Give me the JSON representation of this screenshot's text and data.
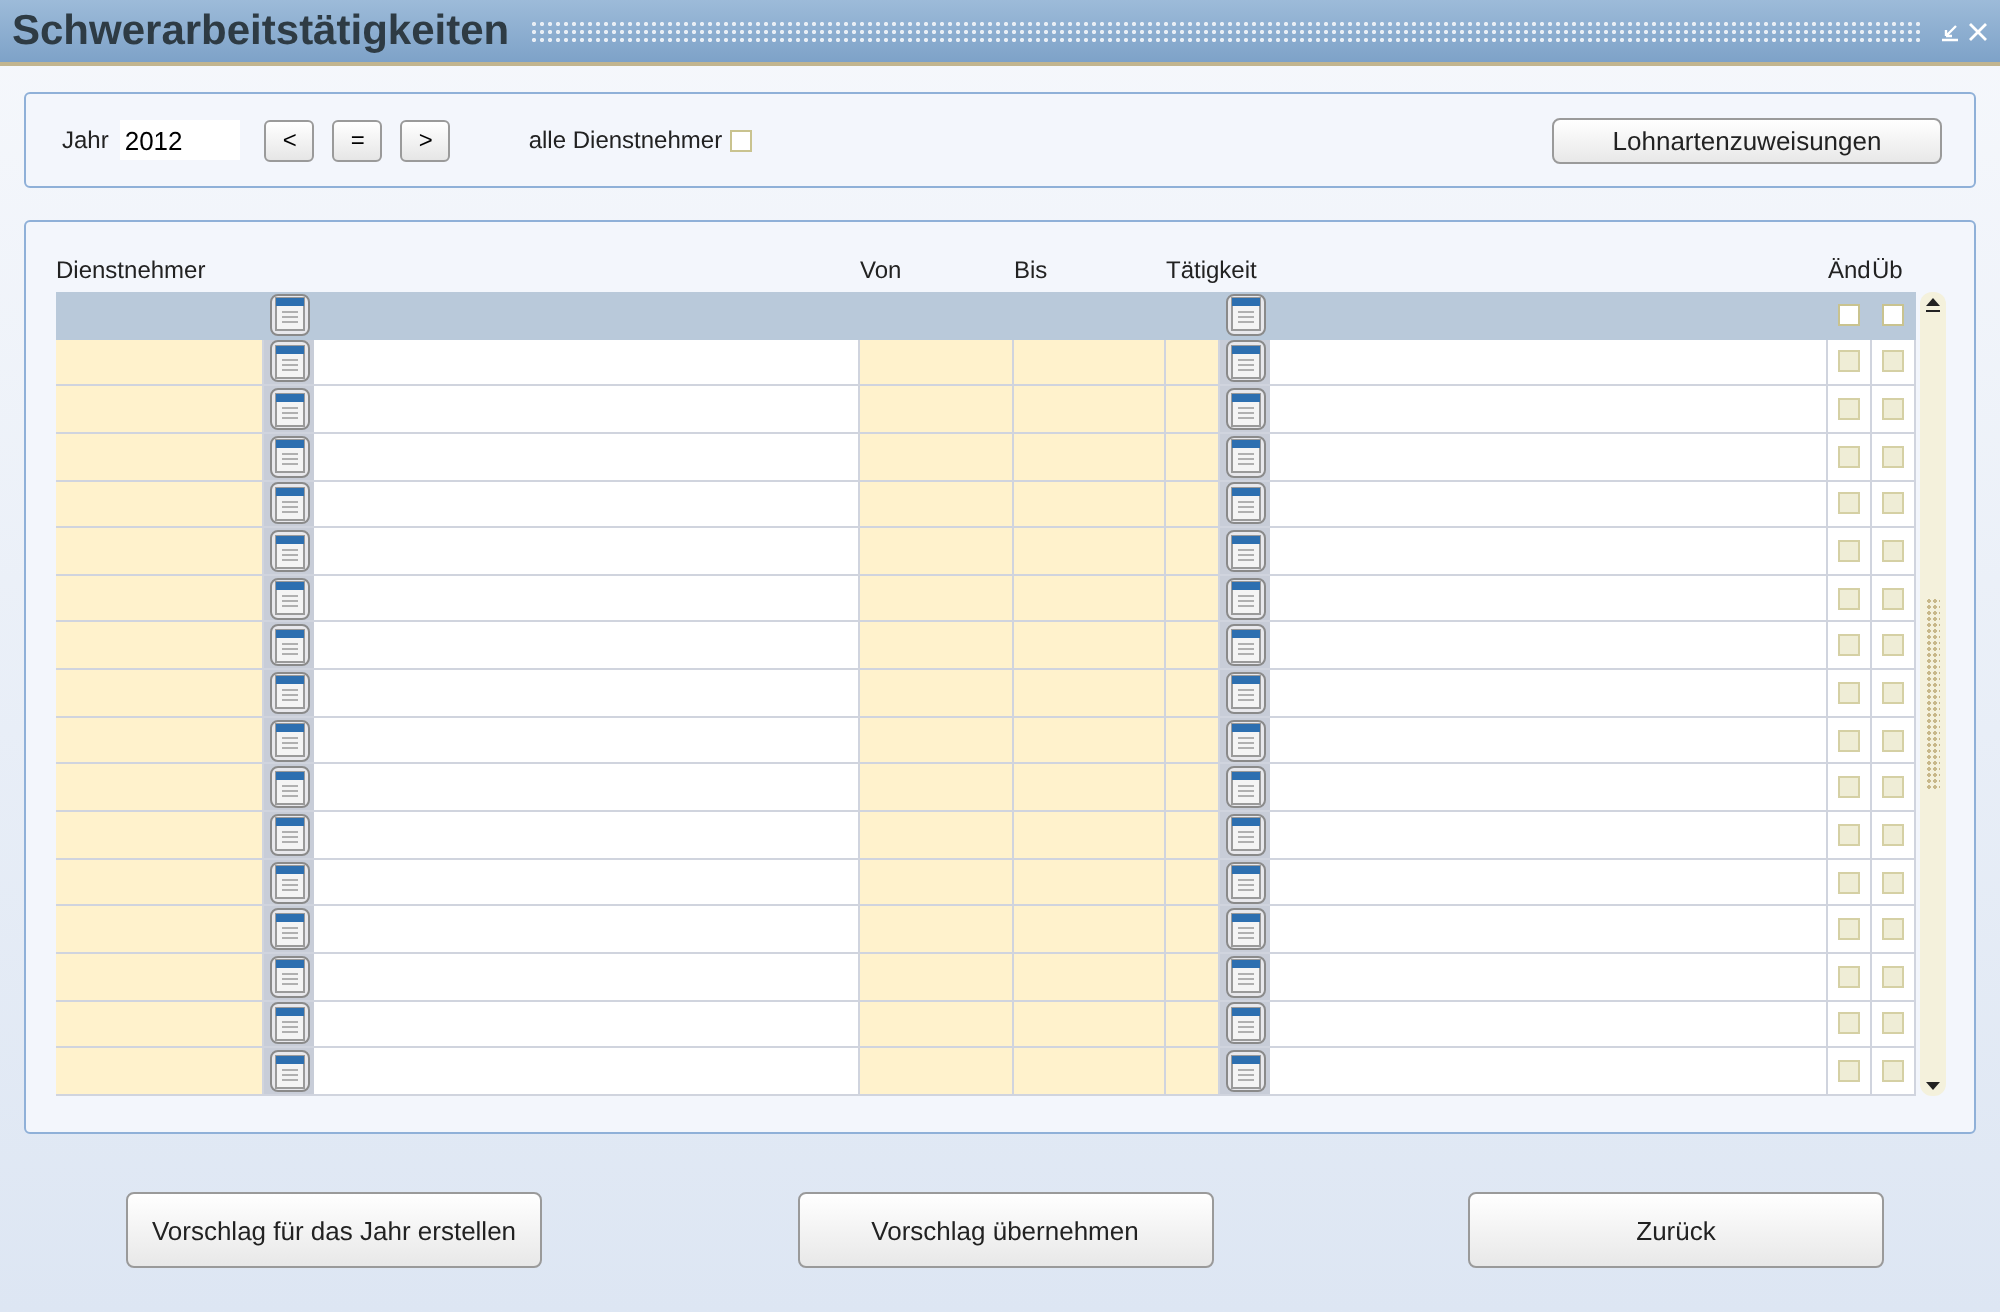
{
  "window": {
    "title": "Schwerarbeitstätigkeiten"
  },
  "filter": {
    "year_label": "Jahr",
    "year": "2012",
    "nav_buttons": [
      "<",
      "=",
      ">"
    ],
    "all_employees": {
      "label": "alle Dienstnehmer",
      "checked": false
    },
    "assign_button": "Lohnartenzuweisungen"
  },
  "table": {
    "columns": [
      "Dienstnehmer",
      "Von",
      "Bis",
      "Tätigkeit",
      "Änd",
      "Üb"
    ],
    "rows": [
      {
        "kind": "filter",
        "changed": false,
        "transferred": false
      },
      {
        "kind": "entry",
        "changed": false,
        "transferred": false
      },
      {
        "kind": "entry",
        "changed": false,
        "transferred": false
      },
      {
        "kind": "entry",
        "changed": false,
        "transferred": false
      },
      {
        "kind": "entry",
        "changed": false,
        "transferred": false
      },
      {
        "kind": "entry",
        "changed": false,
        "transferred": false
      },
      {
        "kind": "entry",
        "changed": false,
        "transferred": false
      },
      {
        "kind": "entry",
        "changed": false,
        "transferred": false
      },
      {
        "kind": "entry",
        "changed": false,
        "transferred": false
      },
      {
        "kind": "entry",
        "changed": false,
        "transferred": false
      },
      {
        "kind": "entry",
        "changed": false,
        "transferred": false
      },
      {
        "kind": "entry",
        "changed": false,
        "transferred": false
      },
      {
        "kind": "entry",
        "changed": false,
        "transferred": false
      },
      {
        "kind": "entry",
        "changed": false,
        "transferred": false
      },
      {
        "kind": "entry",
        "changed": false,
        "transferred": false
      },
      {
        "kind": "entry",
        "changed": false,
        "transferred": false
      },
      {
        "kind": "entry",
        "changed": false,
        "transferred": false
      }
    ]
  },
  "buttons": [
    "Vorschlag für das Jahr erstellen",
    "Vorschlag übernehmen",
    "Zurück"
  ]
}
